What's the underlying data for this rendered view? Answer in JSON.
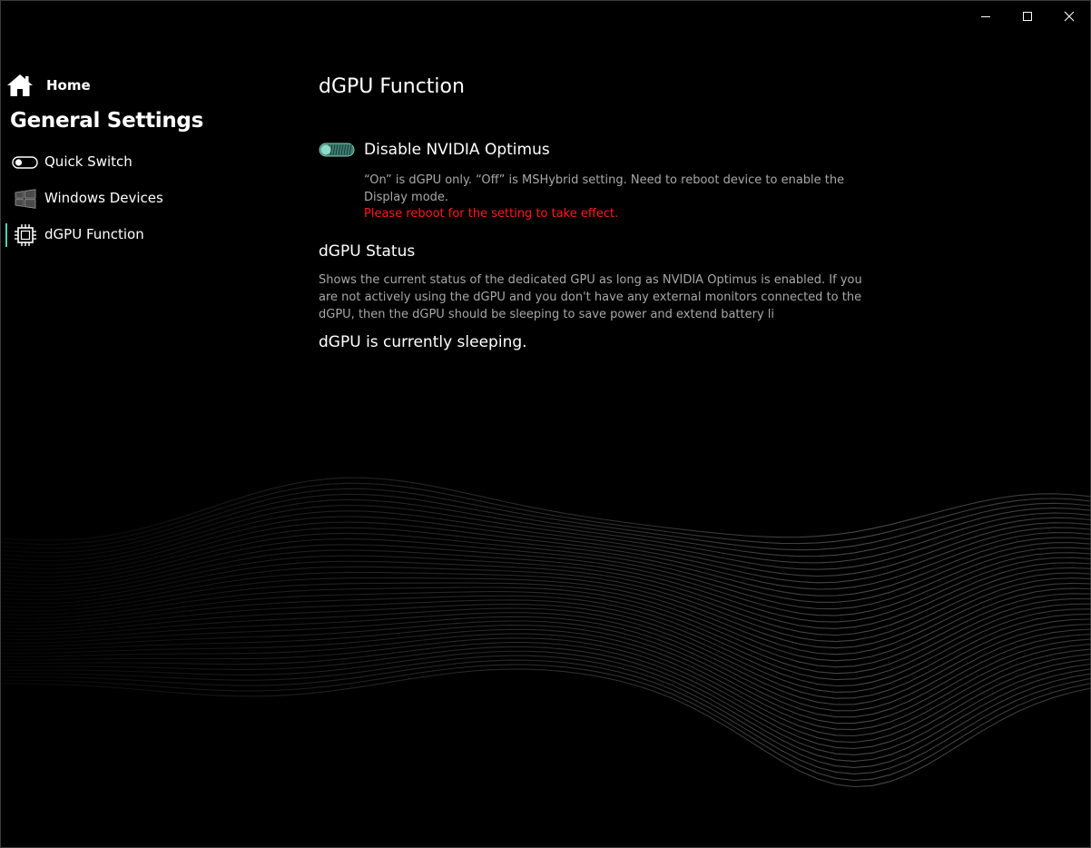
{
  "window": {
    "controls": [
      {
        "name": "minimize-button",
        "icon": "minimize-icon"
      },
      {
        "name": "maximize-button",
        "icon": "maximize-icon"
      },
      {
        "name": "close-button",
        "icon": "close-icon"
      }
    ]
  },
  "sidebar": {
    "home_label": "Home",
    "home_icon": "home-icon",
    "section_title": "General Settings",
    "items": [
      {
        "label": "Quick Switch",
        "icon": "toggle-switch-icon",
        "active": false
      },
      {
        "label": "Windows Devices",
        "icon": "windows-logo-icon",
        "active": false
      },
      {
        "label": "dGPU Function",
        "icon": "gpu-chip-icon",
        "active": true
      }
    ],
    "accent_color": "#4fd1b5"
  },
  "main": {
    "page_title": "dGPU Function",
    "optimus": {
      "label": "Disable NVIDIA Optimus",
      "state": "on",
      "description": "“On” is dGPU only. “Off” is MSHybrid setting. Need to reboot device to enable the Display mode.",
      "warning": "Please reboot for the setting to take effect.",
      "warning_color": "#ff1a1a",
      "toggle_color": "#7cc8b8"
    },
    "status": {
      "title": "dGPU Status",
      "description": "Shows the current status of the dedicated GPU as long as NVIDIA Optimus is enabled. If you are not actively using the dGPU and you don't have any external monitors connected to the dGPU, then the dGPU should be sleeping to save power and extend battery li",
      "value": "dGPU is currently sleeping."
    }
  }
}
